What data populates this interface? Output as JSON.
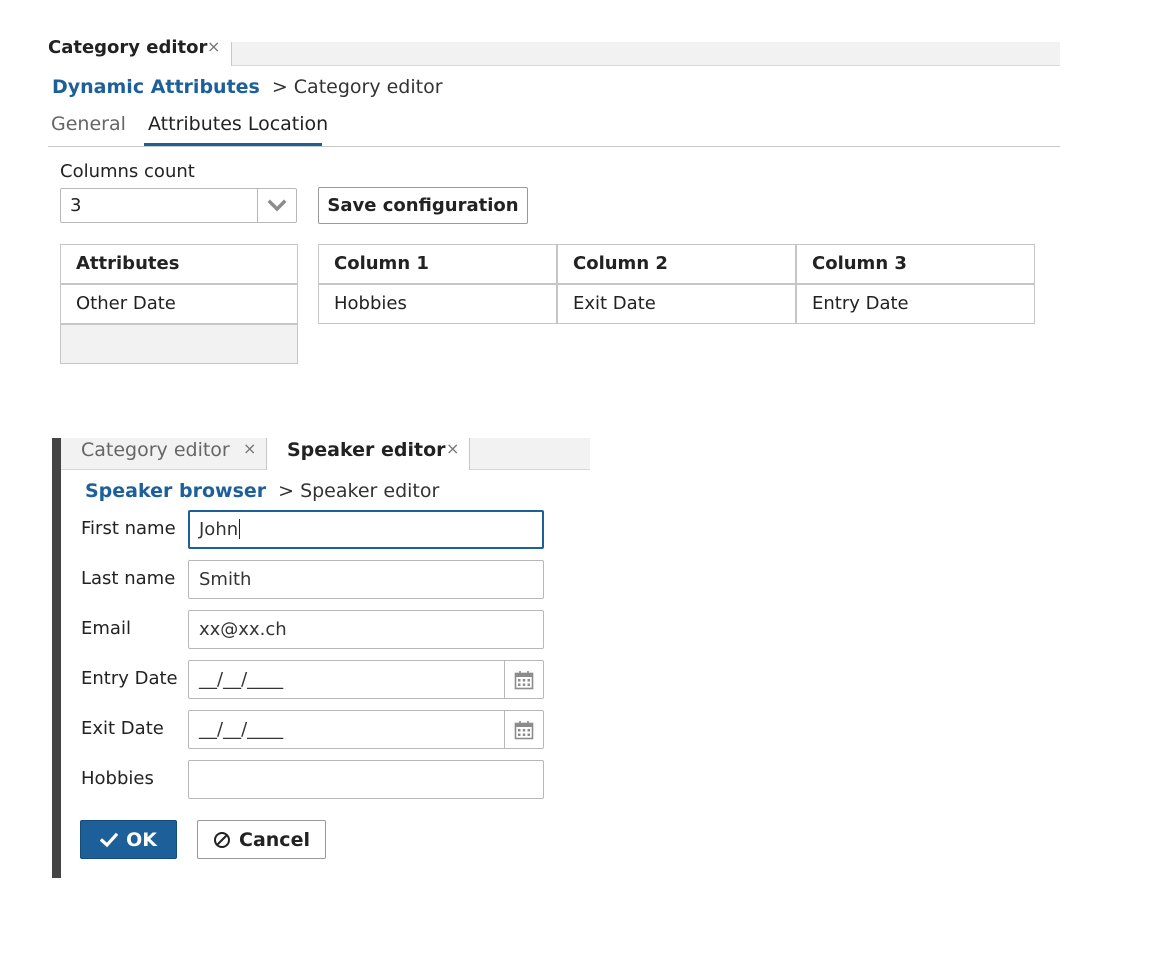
{
  "category_panel": {
    "tab_title": "Category editor",
    "tab_close": "×",
    "breadcrumb": {
      "link": "Dynamic Attributes",
      "separator": ">",
      "current": "Category editor"
    },
    "tabs": [
      "General",
      "Attributes Location"
    ],
    "active_tab": "Attributes Location",
    "columns_count_label": "Columns count",
    "columns_count_value": "3",
    "save_button": "Save configuration",
    "attributes_grid": {
      "header": "Attributes",
      "rows": [
        "Other Date"
      ]
    },
    "columns_grid": [
      {
        "header": "Column 1",
        "rows": [
          "Hobbies"
        ]
      },
      {
        "header": "Column 2",
        "rows": [
          "Exit Date"
        ]
      },
      {
        "header": "Column 3",
        "rows": [
          "Entry Date"
        ]
      }
    ]
  },
  "speaker_panel": {
    "tabs": [
      {
        "label": "Category editor",
        "close": "×",
        "active": false
      },
      {
        "label": "Speaker editor",
        "close": "×",
        "active": true
      }
    ],
    "breadcrumb": {
      "link": "Speaker browser",
      "separator": ">",
      "current": "Speaker editor"
    },
    "fields": {
      "first_name": {
        "label": "First name",
        "value": "John"
      },
      "last_name": {
        "label": "Last name",
        "value": "Smith"
      },
      "email": {
        "label": "Email",
        "value": "xx@xx.ch"
      },
      "entry_date": {
        "label": "Entry Date",
        "value": "__/__/____",
        "icon": "calendar-icon"
      },
      "exit_date": {
        "label": "Exit Date",
        "value": "__/__/____",
        "icon": "calendar-icon"
      },
      "hobbies": {
        "label": "Hobbies",
        "value": ""
      }
    },
    "ok_button": {
      "label": "OK",
      "icon": "checkmark-icon"
    },
    "cancel_button": {
      "label": "Cancel",
      "icon": "cancel-circle-icon"
    }
  },
  "colors": {
    "accent": "#1d5f99",
    "left_bar": "#444444",
    "empty_cell": "#f2f2f2"
  }
}
